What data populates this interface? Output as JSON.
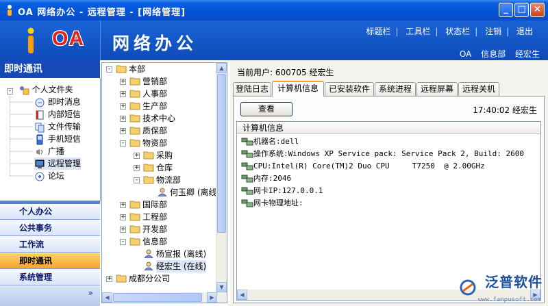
{
  "window": {
    "title": "OA 网络办公 - 远程管理 - [网络管理]",
    "min": "_",
    "max": "□",
    "close": "×"
  },
  "header": {
    "logo_text": "OA",
    "app_title": "网络办公",
    "menu": [
      "标题栏",
      "工具栏",
      "状态栏",
      "注销",
      "退出"
    ],
    "user_line": [
      "OA",
      "信息部",
      "经宏生"
    ]
  },
  "left": {
    "title": "即时通讯",
    "tree_root": "个人文件夹",
    "tree_items": [
      "即时消息",
      "内部短信",
      "文件传输",
      "手机短信",
      "广播",
      "远程管理",
      "论坛"
    ],
    "selected": "远程管理",
    "nav": [
      "个人办公",
      "公共事务",
      "工作流",
      "即时通讯",
      "系统管理"
    ],
    "active_nav": "即时通讯",
    "nav_more": "»"
  },
  "org_tree": {
    "root": "本部",
    "nodes": [
      {
        "label": "营销部",
        "level": 1,
        "type": "folder",
        "expander": "+"
      },
      {
        "label": "人事部",
        "level": 1,
        "type": "folder",
        "expander": "+"
      },
      {
        "label": "生产部",
        "level": 1,
        "type": "folder",
        "expander": "+"
      },
      {
        "label": "技术中心",
        "level": 1,
        "type": "folder",
        "expander": "+"
      },
      {
        "label": "质保部",
        "level": 1,
        "type": "folder",
        "expander": "+"
      },
      {
        "label": "物资部",
        "level": 1,
        "type": "folder",
        "expander": "-"
      },
      {
        "label": "采购",
        "level": 2,
        "type": "folder",
        "expander": "+"
      },
      {
        "label": "仓库",
        "level": 2,
        "type": "folder",
        "expander": "+"
      },
      {
        "label": "物流部",
        "level": 2,
        "type": "folder",
        "expander": "-"
      },
      {
        "label": "何玉卿 (离线)",
        "level": 3,
        "type": "user",
        "expander": ""
      },
      {
        "label": "国际部",
        "level": 1,
        "type": "folder",
        "expander": "+"
      },
      {
        "label": "工程部",
        "level": 1,
        "type": "folder",
        "expander": "+"
      },
      {
        "label": "开发部",
        "level": 1,
        "type": "folder",
        "expander": "+"
      },
      {
        "label": "信息部",
        "level": 1,
        "type": "folder",
        "expander": "-"
      },
      {
        "label": "杨宣报 (离线)",
        "level": 2,
        "type": "user",
        "expander": ""
      },
      {
        "label": "经宏生 (在线)",
        "level": 2,
        "type": "user",
        "expander": ""
      },
      {
        "label": "成都分公司",
        "level": 0,
        "type": "folder",
        "expander": "+"
      }
    ]
  },
  "main": {
    "current_user_label": "当前用户: 600705 经宏生",
    "tabs": [
      "登陆日志",
      "计算机信息",
      "已安装软件",
      "系统进程",
      "远程屏幕",
      "远程关机"
    ],
    "active_tab": "计算机信息",
    "query_button": "查看",
    "time_user": "17:40:02 经宏生",
    "info_header": "计算机信息",
    "info_rows": [
      "机器名:dell",
      "操作系统:Windows XP Service pack: Service Pack 2, Build: 2600",
      "CPU:Intel(R) Core(TM)2 Duo CPU     T7250  @ 2.00GHz",
      "内存:2046",
      "网卡IP:127.0.0.1",
      "网卡物理地址:"
    ]
  },
  "watermark": {
    "brand": "泛普软件",
    "url": "www.fanpusoft.com"
  },
  "colors": {
    "title_blue": "#0353d8",
    "header_blue": "#1557c8",
    "active_nav": "#f3a42a",
    "active_tab_accent": "#f7a21c",
    "logo_red": "#e02418"
  }
}
